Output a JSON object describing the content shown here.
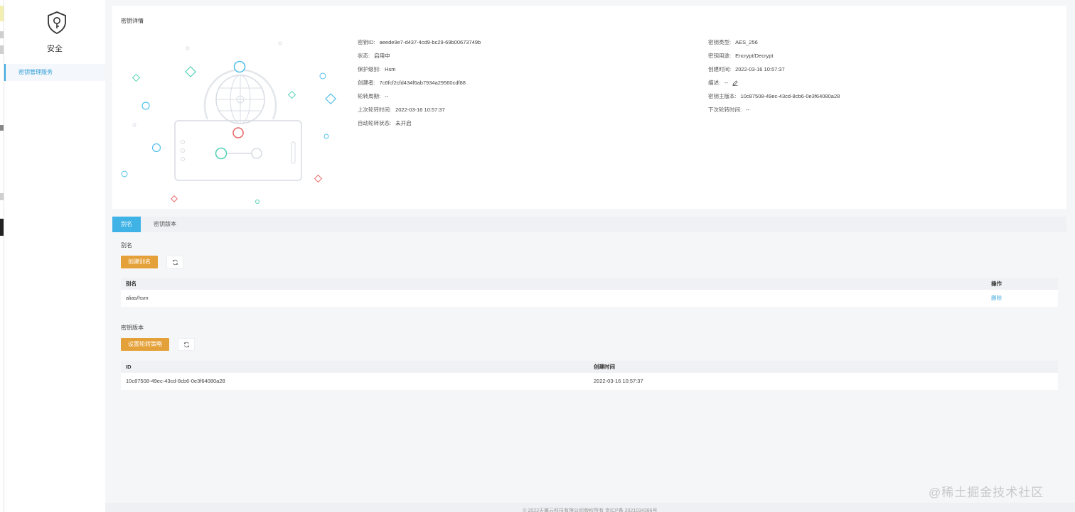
{
  "sidebar": {
    "title": "安全",
    "items": [
      {
        "label": "密钥管理服务"
      }
    ]
  },
  "detail": {
    "title": "密钥详情",
    "left": [
      {
        "label": "密钥ID:",
        "value": "aeede9e7-d437-4cd9-bc29-69b00673749b"
      },
      {
        "label": "状态:",
        "value": "启用中"
      },
      {
        "label": "保护级别:",
        "value": "Hsm"
      },
      {
        "label": "创建者:",
        "value": "7c6fcf2cfd434f6ab7934a29560cdf88"
      },
      {
        "label": "轮转周期:",
        "value": "--"
      },
      {
        "label": "上次轮转时间:",
        "value": "2022-03-16 10:57:37"
      },
      {
        "label": "自动轮转状态:",
        "value": "未开启"
      }
    ],
    "right": [
      {
        "label": "密钥类型:",
        "value": "AES_256"
      },
      {
        "label": "密钥用途:",
        "value": "Encrypt/Decrypt"
      },
      {
        "label": "创建时间:",
        "value": "2022-03-16 10:57:37"
      },
      {
        "label": "描述:",
        "value": "--"
      },
      {
        "label": "密钥主版本:",
        "value": "10c87508-49ec-43cd-8cb6-0e3f64080a28"
      },
      {
        "label": "下次轮转时间:",
        "value": "--"
      }
    ]
  },
  "tabs": [
    {
      "label": "别名",
      "active": true
    },
    {
      "label": "密钥版本",
      "active": false
    }
  ],
  "alias_section": {
    "title": "别名",
    "create_button": "创建别名",
    "columns": [
      "别名",
      "操作"
    ],
    "rows": [
      {
        "alias": "alias/hsm",
        "action": "删除"
      }
    ]
  },
  "version_section": {
    "title": "密钥版本",
    "policy_button": "设置轮转策略",
    "columns": [
      "ID",
      "创建时间"
    ],
    "rows": [
      {
        "id": "10c87508-49ec-43cd-8cb6-0e3f64080a28",
        "created": "2022-03-16 10:57:37"
      }
    ]
  },
  "footer": {
    "text": "© 2022天翼云科技有限公司版权所有 京ICP备 2021034386号"
  },
  "watermark": "@稀土掘金技术社区",
  "colors": {
    "accent": "#3fb2e6",
    "orange": "#e5a139",
    "link": "#3fa6dd"
  },
  "icons": [
    "shield-key-icon",
    "refresh-icon",
    "edit-icon"
  ]
}
